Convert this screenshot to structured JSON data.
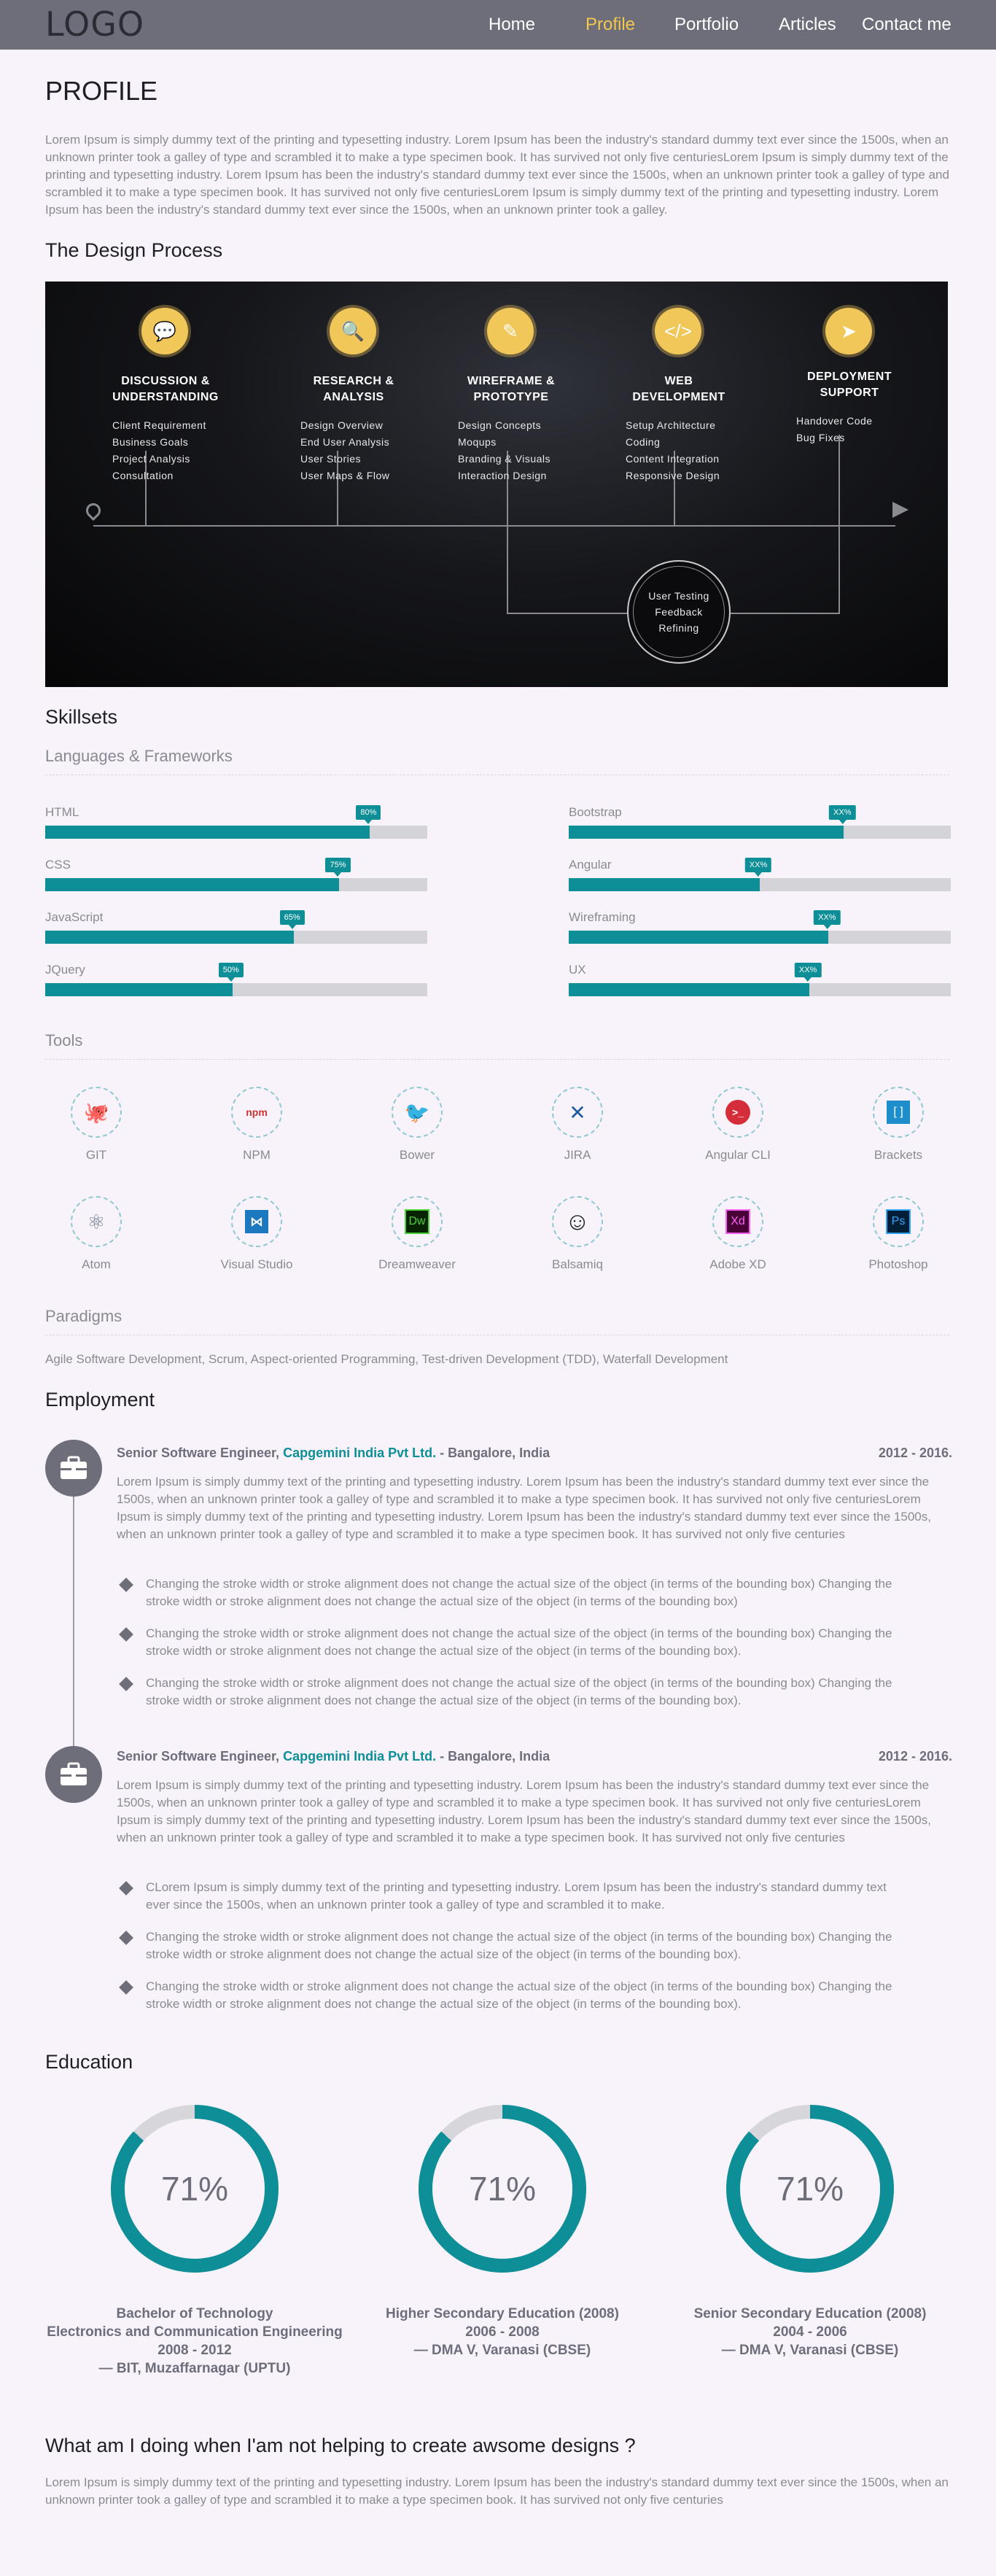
{
  "nav": {
    "logo": "LOGO",
    "items": [
      "Home",
      "Profile",
      "Portfolio",
      "Articles",
      "Contact me"
    ],
    "active_color": "#f5c84b"
  },
  "profile": {
    "title": "PROFILE",
    "text": "Lorem Ipsum is simply dummy text of the printing and typesetting industry. Lorem Ipsum has been the industry's standard dummy text ever since the 1500s, when an unknown printer took a galley of type and scrambled it to make a type specimen book. It has survived not only five centuriesLorem Ipsum is simply dummy text of the printing and typesetting industry. Lorem Ipsum has been the industry's standard dummy text ever since the 1500s, when an unknown printer took a galley of type and scrambled it to make a type specimen book. It has survived not only five centuriesLorem Ipsum is simply dummy text of the printing and typesetting industry. Lorem Ipsum has been the industry's standard dummy text ever since the 1500s, when an unknown printer took a galley."
  },
  "design": {
    "title": "The Design Process",
    "steps": [
      {
        "icon": "speech-bubbles-icon",
        "title": "DISCUSSION & UNDERSTANDING",
        "items": [
          "Client Requirement",
          "Business Goals",
          "Project Analysis",
          "Consultation"
        ]
      },
      {
        "icon": "magnifier-icon",
        "title": "RESEARCH & ANALYSIS",
        "items": [
          "Design Overview",
          "End User Analysis",
          "User Stories",
          "User Maps & Flow"
        ]
      },
      {
        "icon": "paint-tools-icon",
        "title": "WIREFRAME & PROTOTYPE",
        "items": [
          "Design Concepts",
          "Moqups",
          "Branding & Visuals",
          "Interaction Design"
        ]
      },
      {
        "icon": "code-icon",
        "title": "WEB DEVELOPMENT",
        "items": [
          "Setup Architecture",
          "Coding",
          "Content Integration",
          "Responsive Design"
        ]
      },
      {
        "icon": "paper-plane-icon",
        "title": "DEPLOYMENT SUPPORT",
        "items": [
          "Handover Code",
          "Bug Fixes"
        ]
      }
    ],
    "loop": [
      "User Testing",
      "Feedback",
      "Refining"
    ]
  },
  "skills": {
    "title": "Skillsets",
    "languages_title": "Languages & Frameworks",
    "items": [
      {
        "name": "HTML",
        "tag": "80%",
        "value": 0.85
      },
      {
        "name": "CSS",
        "tag": "75%",
        "value": 0.77
      },
      {
        "name": "JavaScript",
        "tag": "65%",
        "value": 0.65
      },
      {
        "name": "JQuery",
        "tag": "50%",
        "value": 0.49
      },
      {
        "name": "Bootstrap",
        "tag": "XX%",
        "value": 0.72
      },
      {
        "name": "Angular",
        "tag": "XX%",
        "value": 0.5
      },
      {
        "name": "Wireframing",
        "tag": "XX%",
        "value": 0.68
      },
      {
        "name": "UX",
        "tag": "XX%",
        "value": 0.63
      }
    ],
    "accent": "#0e8e97"
  },
  "tools": {
    "title": "Tools",
    "items": [
      {
        "name": "GIT",
        "icon": "octocat-icon"
      },
      {
        "name": "NPM",
        "icon": "npm-icon"
      },
      {
        "name": "Bower",
        "icon": "bower-icon"
      },
      {
        "name": "JIRA",
        "icon": "jira-icon"
      },
      {
        "name": "Angular CLI",
        "icon": "terminal-icon"
      },
      {
        "name": "Brackets",
        "icon": "brackets-icon"
      },
      {
        "name": "Atom",
        "icon": "atom-icon"
      },
      {
        "name": "Visual Studio",
        "icon": "visual-studio-icon"
      },
      {
        "name": "Dreamweaver",
        "icon": "dreamweaver-icon"
      },
      {
        "name": "Balsamiq",
        "icon": "smiley-icon"
      },
      {
        "name": "Adobe XD",
        "icon": "adobe-xd-icon"
      },
      {
        "name": "Photoshop",
        "icon": "photoshop-icon"
      }
    ]
  },
  "paradigms": {
    "title": "Paradigms",
    "text": "Agile Software Development, Scrum, Aspect-oriented Programming, Test-driven Development (TDD), Waterfall Development"
  },
  "employment": {
    "title": "Employment",
    "jobs": [
      {
        "role": "Senior Software Engineer,",
        "company": "Capgemini India Pvt Ltd.",
        "location": " - Bangalore, India",
        "dates": "2012 - 2016.",
        "desc": "Lorem Ipsum is simply dummy text of the printing and typesetting industry. Lorem Ipsum has been the industry's standard dummy text ever since the 1500s, when an unknown printer took a galley of type and scrambled it to make a type specimen book. It has survived not only five centuriesLorem Ipsum is simply dummy text of the printing and typesetting industry. Lorem Ipsum has been the industry's standard dummy text ever since the 1500s, when an unknown printer took a galley of type and scrambled it to make a type specimen book. It has survived not only five centuries",
        "bullets": [
          "Changing the stroke width or stroke alignment does not change the actual size of the object (in terms of the bounding box) Changing the stroke width or stroke alignment does not change the actual size of the object (in terms of the bounding box)",
          "Changing the stroke width or stroke alignment does not change the actual size of the object (in terms of the bounding box) Changing the stroke width or stroke alignment does not change the actual size of the object (in terms of the bounding box).",
          "Changing the stroke width or stroke alignment does not change the actual size of the object (in terms of the bounding box) Changing the stroke width or stroke alignment does not change the actual size of the object (in terms of the bounding box)."
        ]
      },
      {
        "role": "Senior Software Engineer,",
        "company": "Capgemini India Pvt Ltd.",
        "location": " - Bangalore, India",
        "dates": "2012 - 2016.",
        "desc": "Lorem Ipsum is simply dummy text of the printing and typesetting industry. Lorem Ipsum has been the industry's standard dummy text ever since the 1500s, when an unknown printer took a galley of type and scrambled it to make a type specimen book. It has survived not only five centuriesLorem Ipsum is simply dummy text of the printing and typesetting industry. Lorem Ipsum has been the industry's standard dummy text ever since the 1500s, when an unknown printer took a galley of type and scrambled it to make a type specimen book. It has survived not only five centuries",
        "bullets": [
          "CLorem Ipsum is simply dummy text of the printing and typesetting industry. Lorem Ipsum has been the industry's standard dummy text ever since the 1500s, when an unknown printer took a galley of type and scrambled it to make.",
          "Changing the stroke width or stroke alignment does not change the actual size of the object (in terms of the bounding box) Changing the stroke width or stroke alignment does not change the actual size of the object (in terms of the bounding box).",
          "Changing the stroke width or stroke alignment does not change the actual size of the object (in terms of the bounding box) Changing the stroke width or stroke alignment does not change the actual size of the object (in terms of the bounding box)."
        ]
      }
    ]
  },
  "education": {
    "title": "Education",
    "items": [
      {
        "percent": "71%",
        "value": 0.87,
        "lines": [
          "Bachelor of Technology",
          "Electronics and Communication Engineering",
          "2008 - 2012",
          "— BIT, Muzaffarnagar (UPTU)"
        ]
      },
      {
        "percent": "71%",
        "value": 0.87,
        "lines": [
          "Higher Secondary Education (2008)",
          "2006 - 2008",
          "— DMA V, Varanasi (CBSE)"
        ]
      },
      {
        "percent": "71%",
        "value": 0.87,
        "lines": [
          "Senior Secondary Education (2008)",
          "2004 - 2006",
          "— DMA V, Varanasi (CBSE)"
        ]
      }
    ]
  },
  "hobbies": {
    "title": "What am I doing when I'am not helping to create awsome designs ?",
    "text": "Lorem Ipsum is simply dummy text of the printing and typesetting industry. Lorem Ipsum has been the industry's standard dummy text ever since the 1500s, when an unknown printer took a galley of type and scrambled it to make a type specimen book. It has survived not only five centuries"
  }
}
